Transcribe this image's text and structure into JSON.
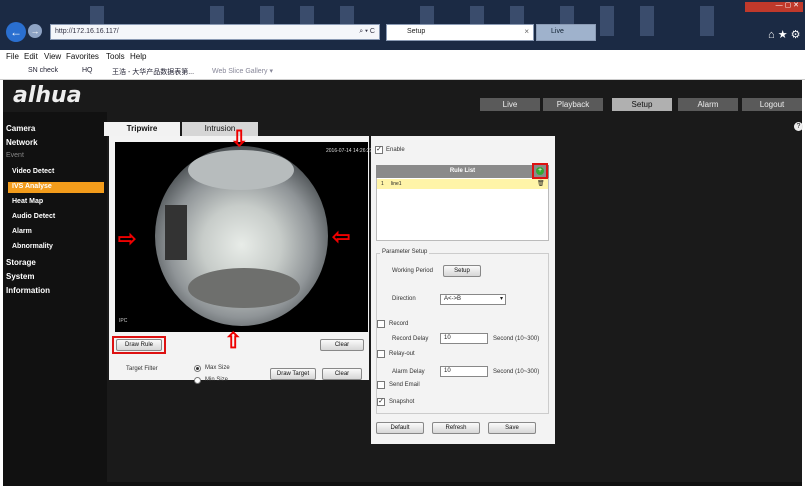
{
  "browser": {
    "address": "http://172.16.16.117/",
    "address_tools": "⌕ ▾ C",
    "tab_active": "Setup",
    "tab_close": "×",
    "tab_other": "Live",
    "window_buttons": "— ▢ ✕",
    "toolbar_icons": "⌂ ★ ⚙",
    "back_glyph": "←",
    "forward_glyph": "→",
    "menu": [
      "File",
      "Edit",
      "View",
      "Favorites",
      "Tools",
      "Help"
    ],
    "favorites": [
      "SN check",
      "HQ",
      "王浩 - 大华产品数据表第...",
      "Web Slice Gallery ▾"
    ]
  },
  "app": {
    "logo": "alhua",
    "nav": [
      "Live",
      "Playback",
      "Setup",
      "Alarm",
      "Logout"
    ],
    "nav_active": "Setup",
    "help_glyph": "?"
  },
  "sidebar": {
    "items": [
      {
        "label": "Camera"
      },
      {
        "label": "Network"
      },
      {
        "label": "Event"
      },
      {
        "label": "Video Detect"
      },
      {
        "label": "IVS Analyse"
      },
      {
        "label": "Heat Map"
      },
      {
        "label": "Audio Detect"
      },
      {
        "label": "Alarm"
      },
      {
        "label": "Abnormality"
      },
      {
        "label": "Storage"
      },
      {
        "label": "System"
      },
      {
        "label": "Information"
      }
    ]
  },
  "tabs": [
    "Tripwire",
    "Intrusion"
  ],
  "video": {
    "timestamp": "2016-07-14 14:26:27",
    "channel": "IPC"
  },
  "arrows": {
    "up": "⇩",
    "left": "⇨",
    "right": "⇦",
    "down": "⇧"
  },
  "left_controls": {
    "draw_rule": "Draw Rule",
    "clear1": "Clear",
    "target_filter_label": "Target Filter",
    "max_size": "Max Size",
    "min_size": "Min Size",
    "draw_target": "Draw Target",
    "clear2": "Clear"
  },
  "right": {
    "enable_label": "Enable",
    "enable_check": "✓",
    "rule_list_title": "Rule List",
    "add_rule": "+",
    "rule_index": "1",
    "rule_name": "line1",
    "delete_glyph": "🗑",
    "param_title": "Parameter Setup",
    "working_period_label": "Working Period",
    "working_period_btn": "Setup",
    "direction_label": "Direction",
    "direction_value": "A<->B",
    "record_label": "Record",
    "record_delay_label": "Record Delay",
    "record_delay_value": "10",
    "record_delay_unit": "Second (10~300)",
    "relay_out_label": "Relay-out",
    "alarm_delay_label": "Alarm Delay",
    "alarm_delay_value": "10",
    "alarm_delay_unit": "Second (10~300)",
    "send_email_label": "Send Email",
    "snapshot_label": "Snapshot",
    "snapshot_check": "✓",
    "default_btn": "Default",
    "refresh_btn": "Refresh",
    "save_btn": "Save"
  }
}
